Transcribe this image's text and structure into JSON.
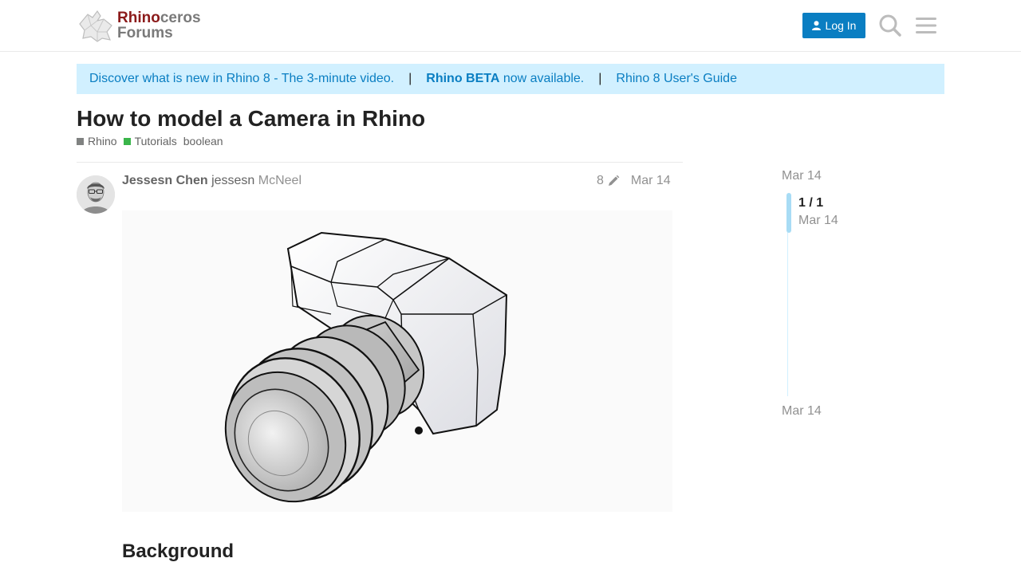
{
  "header": {
    "logo": {
      "line1_a": "Rhino",
      "line1_b": "ceros",
      "line2": "Forums"
    },
    "login_label": "Log In"
  },
  "banner": {
    "link1": "Discover what is new in Rhino 8 - The 3-minute video.",
    "sep": "|",
    "beta_bold": "Rhino BETA",
    "beta_rest": " now available.",
    "link3": "Rhino 8 User's Guide"
  },
  "topic": {
    "title": "How to model a Camera in Rhino",
    "categories": [
      {
        "name": "Rhino",
        "color": "#808281"
      },
      {
        "name": "Tutorials",
        "color": "#3ab54a"
      }
    ],
    "tag": "boolean"
  },
  "post": {
    "full_name": "Jessesn Chen",
    "username": "jessesn",
    "flair": "McNeel",
    "edit_count": "8",
    "date": "Mar 14",
    "heading": "Background"
  },
  "timeline": {
    "start_date": "Mar 14",
    "position": "1 / 1",
    "position_date": "Mar 14",
    "end_date": "Mar 14"
  },
  "colors": {
    "accent": "#0a7ec2",
    "banner_bg": "#d1f0ff",
    "brand_red": "#8b1a1a"
  }
}
